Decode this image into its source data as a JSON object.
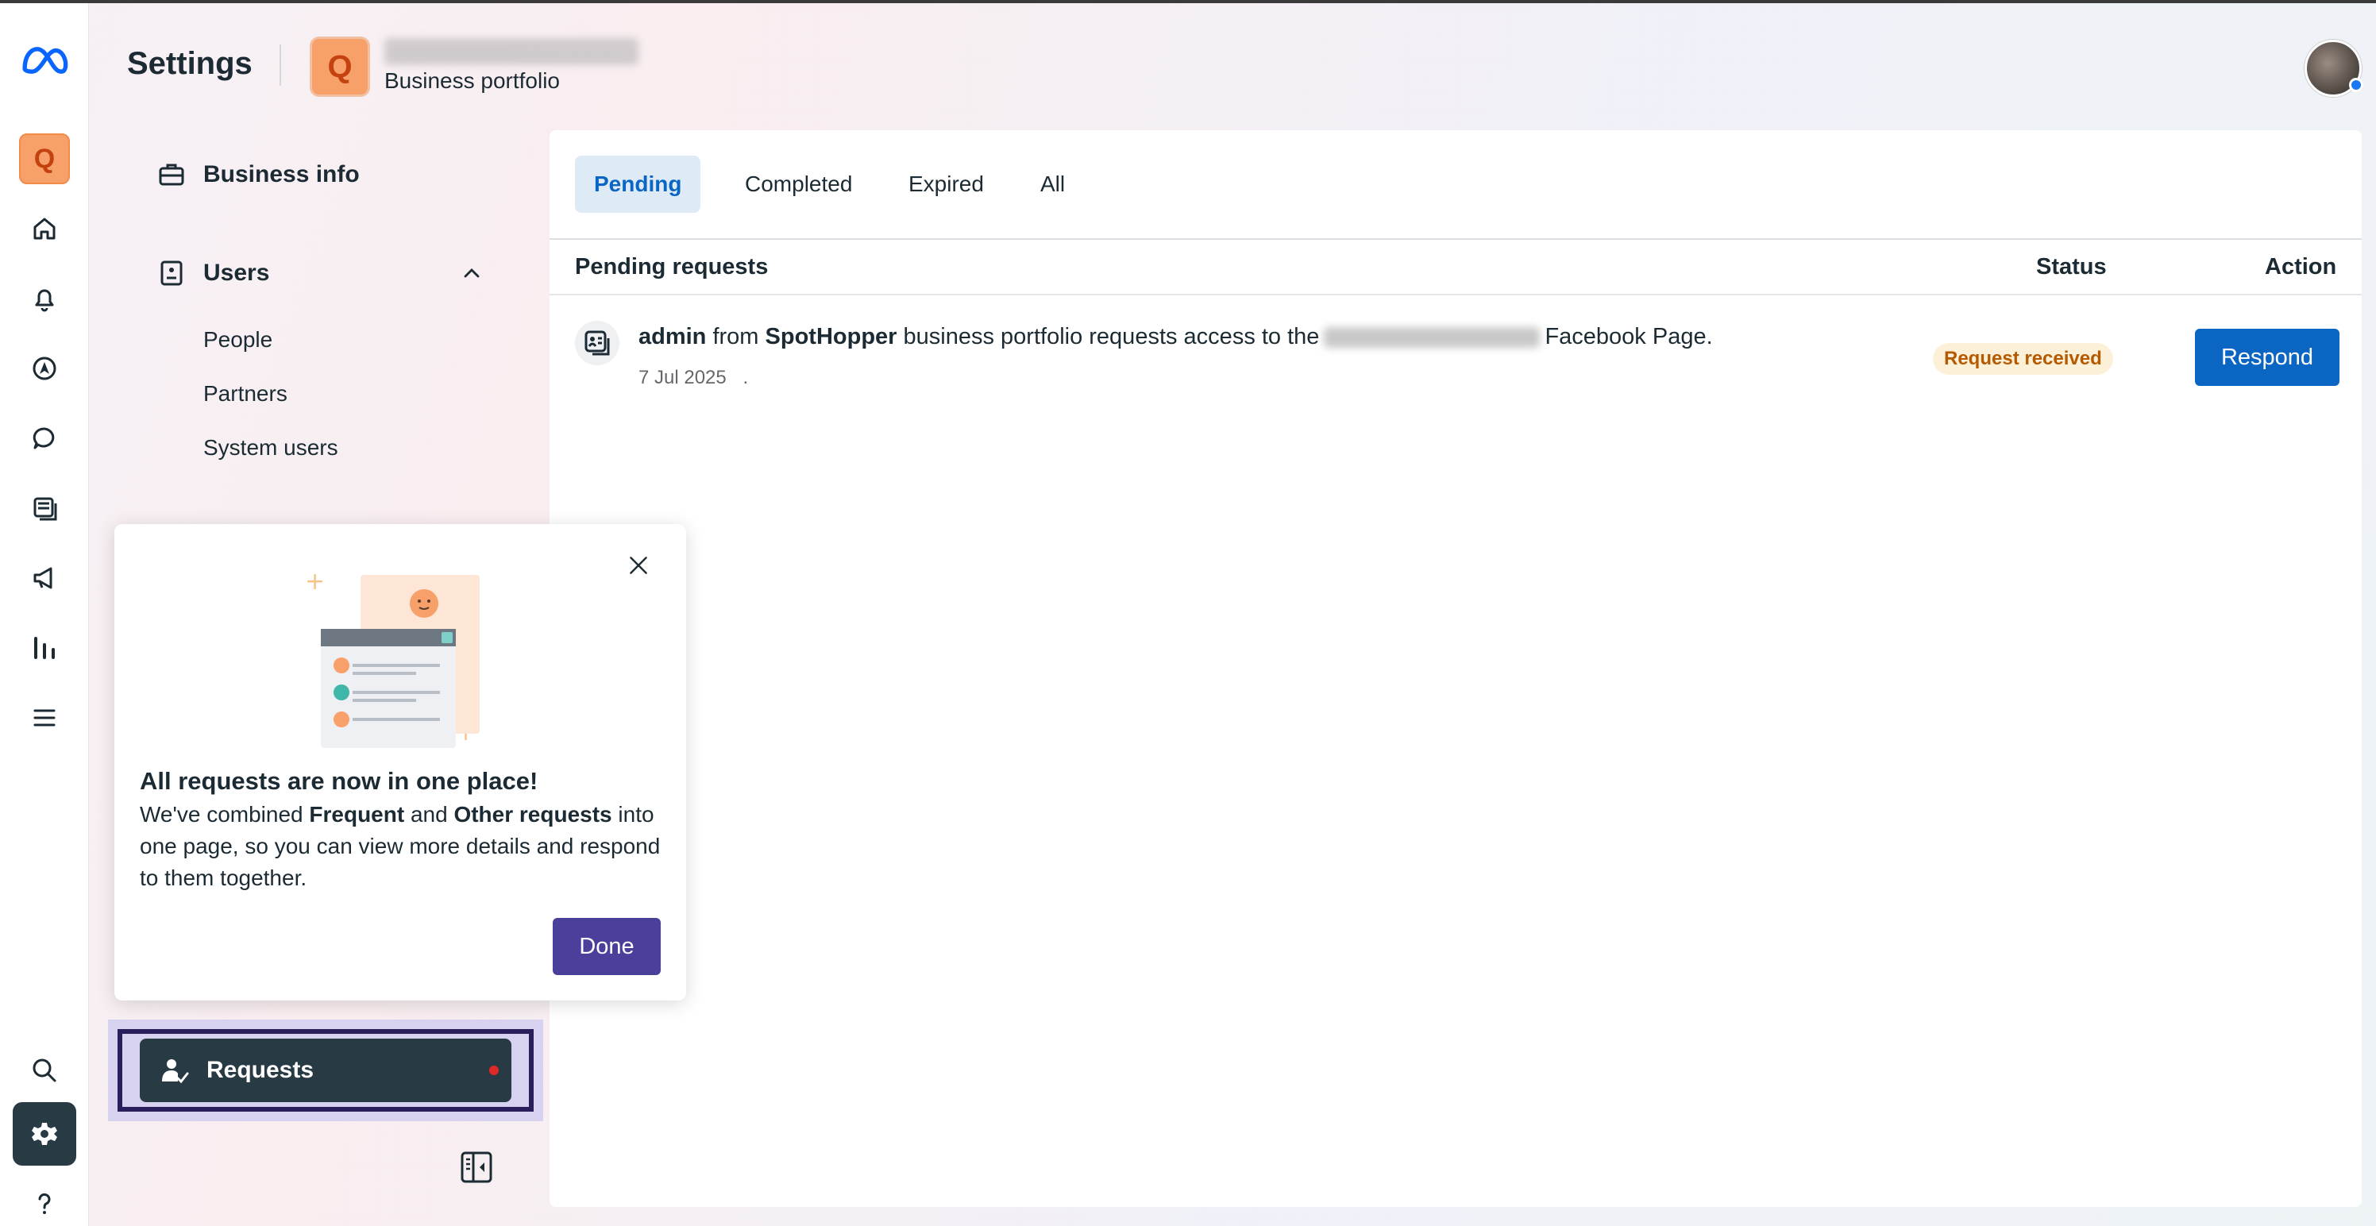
{
  "header": {
    "title": "Settings",
    "portfolio_initial": "Q",
    "portfolio_subtitle": "Business portfolio"
  },
  "rail": {
    "items": [
      "meta-logo",
      "portfolio-q",
      "home-icon",
      "bell-icon",
      "compass-icon",
      "chat-icon",
      "pages-icon",
      "megaphone-icon",
      "insights-icon",
      "menu-icon",
      "search-icon",
      "gear-icon",
      "help-icon"
    ],
    "portfolio_initial": "Q"
  },
  "sidebar": {
    "business_info": "Business info",
    "users": "Users",
    "users_children": [
      "People",
      "Partners",
      "System users"
    ],
    "requests": "Requests"
  },
  "tabs": [
    {
      "label": "Pending",
      "active": true
    },
    {
      "label": "Completed",
      "active": false
    },
    {
      "label": "Expired",
      "active": false
    },
    {
      "label": "All",
      "active": false
    }
  ],
  "table": {
    "headers": {
      "col1": "Pending requests",
      "status": "Status",
      "action": "Action"
    },
    "rows": [
      {
        "requester": "admin",
        "from": "from",
        "company": "SpotHopper",
        "text_mid": "business portfolio requests access to the",
        "text_end": "Facebook Page.",
        "date": "7 Jul 2025",
        "date_suffix": ".",
        "status": "Request received",
        "action": "Respond"
      }
    ]
  },
  "popover": {
    "title": "All requests are now in one place!",
    "body_1": "We've combined ",
    "body_bold_1": "Frequent",
    "body_2": " and ",
    "body_bold_2": "Other requests",
    "body_3": " into one page, so you can view more details and respond to them together.",
    "done": "Done"
  },
  "colors": {
    "primary": "#0a66c2",
    "done_button": "#4a3f9b",
    "status_badge_bg": "#fdf0d8",
    "status_badge_text": "#b55a00",
    "nav_dark": "#283a44",
    "portfolio_orange": "#f7a06a"
  }
}
